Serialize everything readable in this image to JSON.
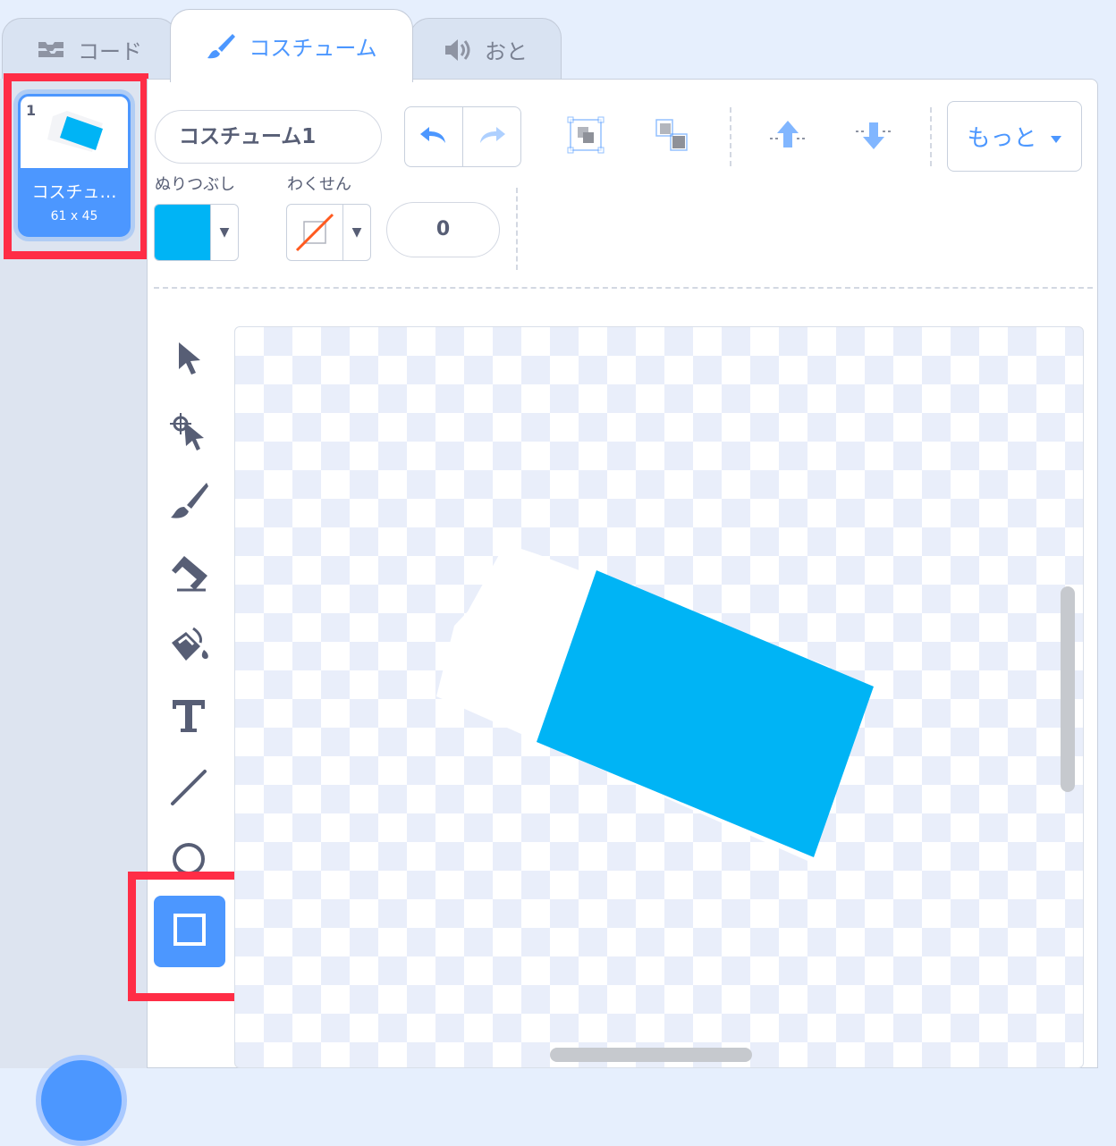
{
  "tabs": [
    {
      "label": "コード",
      "icon": "code-blocks-icon"
    },
    {
      "label": "コスチューム",
      "icon": "paintbrush-icon"
    },
    {
      "label": "おと",
      "icon": "speaker-icon"
    }
  ],
  "costume_list": {
    "items": [
      {
        "number": "1",
        "name": "コスチュ…",
        "size": "61 x 45",
        "selected": true
      }
    ]
  },
  "toolbar": {
    "costume_name": "コスチューム1",
    "undo_icon": "undo-icon",
    "redo_icon": "redo-icon",
    "group_icon": "group-icon",
    "ungroup_icon": "ungroup-icon",
    "forward_icon": "forward-layer-icon",
    "backward_icon": "backward-layer-icon",
    "more_label": "もっと"
  },
  "fill": {
    "label": "ぬりつぶし",
    "color": "#00b4f5"
  },
  "outline": {
    "label": "わくせん",
    "color": "none",
    "width": "0"
  },
  "tools": [
    {
      "name": "select-tool-icon"
    },
    {
      "name": "reshape-tool-icon"
    },
    {
      "name": "brush-tool-icon"
    },
    {
      "name": "eraser-tool-icon"
    },
    {
      "name": "fill-tool-icon"
    },
    {
      "name": "text-tool-icon"
    },
    {
      "name": "line-tool-icon"
    },
    {
      "name": "circle-tool-icon"
    },
    {
      "name": "rectangle-tool-icon",
      "selected": true
    }
  ],
  "colors": {
    "accent": "#4c97ff",
    "highlight": "#ff2d46",
    "shape_fill": "#00b4f5"
  }
}
